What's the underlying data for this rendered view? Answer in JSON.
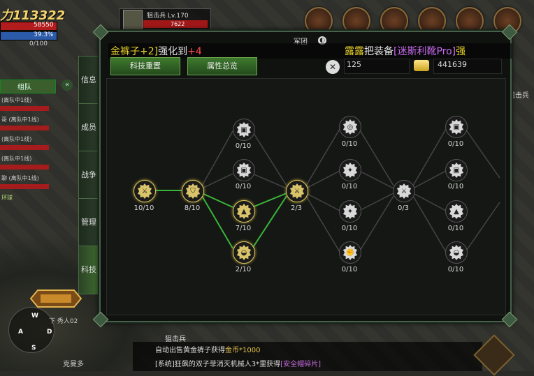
{
  "hud": {
    "power": "力113322",
    "hp_text": "58550",
    "mp_text": "39.3%",
    "exp_text": "0/100",
    "target_name": "狙击兵 Lv.170",
    "target_hp": "7622",
    "team_tab": "组队",
    "team_members": [
      "(离队中1线)",
      "哥 (离队中1线)",
      "(离队中1线)",
      "(离队中1线)",
      "聊 (离队中1线)",
      "(离队中1线)"
    ],
    "team_extra": "环球",
    "compass": {
      "w": "W",
      "a": "A",
      "d": "D",
      "s": "S"
    },
    "player_name": "下 秀人02",
    "guild": "克曼多",
    "sniper_label_bottom": "狙击兵",
    "sniper_label_right": "狙击兵",
    "chat_line1_prefix": "自动出售黄金裤子获得",
    "chat_line1_gold": "金币*1000",
    "chat_line2_prefix": "[系统]狂飙的双子菲消灭机械人3*里获得",
    "chat_line2_item": "[安全帽碎片]"
  },
  "panel": {
    "title": "军团",
    "notice_left_prefix": "金裤子+2]",
    "notice_left_mid": "强化到",
    "notice_left_value": "+4",
    "notice_right_name": "露露",
    "notice_right_mid": "把装备",
    "notice_right_item": "[迷斯利靴Pro]",
    "notice_right_tail": "强",
    "btn_reset": "科技重置",
    "btn_overview": "属性总览",
    "res_value_1": "125",
    "res_value_2": "441639"
  },
  "side_tabs": [
    {
      "label": "信息"
    },
    {
      "label": "成员"
    },
    {
      "label": "战争"
    },
    {
      "label": "管理"
    },
    {
      "label": "科技"
    }
  ],
  "tree_nodes": [
    {
      "id": "n1",
      "value": "10/10",
      "active": true,
      "icon": "swords-icon"
    },
    {
      "id": "n2",
      "value": "8/10",
      "active": true,
      "icon": "shield-icon"
    },
    {
      "id": "n3a",
      "value": "0/10",
      "active": false,
      "icon": "armor-icon"
    },
    {
      "id": "n3b",
      "value": "0/10",
      "active": false,
      "icon": "armor-icon"
    },
    {
      "id": "n3c",
      "value": "7/10",
      "active": true,
      "icon": "boot-icon"
    },
    {
      "id": "n3d",
      "value": "2/10",
      "active": true,
      "icon": "helmet-icon"
    },
    {
      "id": "n4",
      "value": "2/3",
      "active": true,
      "icon": "swords-icon"
    },
    {
      "id": "n5a",
      "value": "0/10",
      "active": false,
      "icon": "target-icon"
    },
    {
      "id": "n5b",
      "value": "0/10",
      "active": false,
      "icon": "sword-icon"
    },
    {
      "id": "n5c",
      "value": "0/10",
      "active": false,
      "icon": "sword-icon"
    },
    {
      "id": "n5d",
      "value": "0/10",
      "active": false,
      "icon": "fist-icon"
    },
    {
      "id": "n6",
      "value": "0/3",
      "active": false,
      "icon": "swords-icon"
    },
    {
      "id": "n7a",
      "value": "0/10",
      "active": false,
      "icon": "armor-icon"
    },
    {
      "id": "n7b",
      "value": "0/10",
      "active": false,
      "icon": "armor-icon"
    },
    {
      "id": "n7c",
      "value": "0/10",
      "active": false,
      "icon": "boot-icon"
    },
    {
      "id": "n7d",
      "value": "0/10",
      "active": false,
      "icon": "helmet-icon"
    }
  ],
  "colors": {
    "accent_green": "#39b53a",
    "gold": "#d9c46a",
    "panel_border": "#46604a"
  }
}
